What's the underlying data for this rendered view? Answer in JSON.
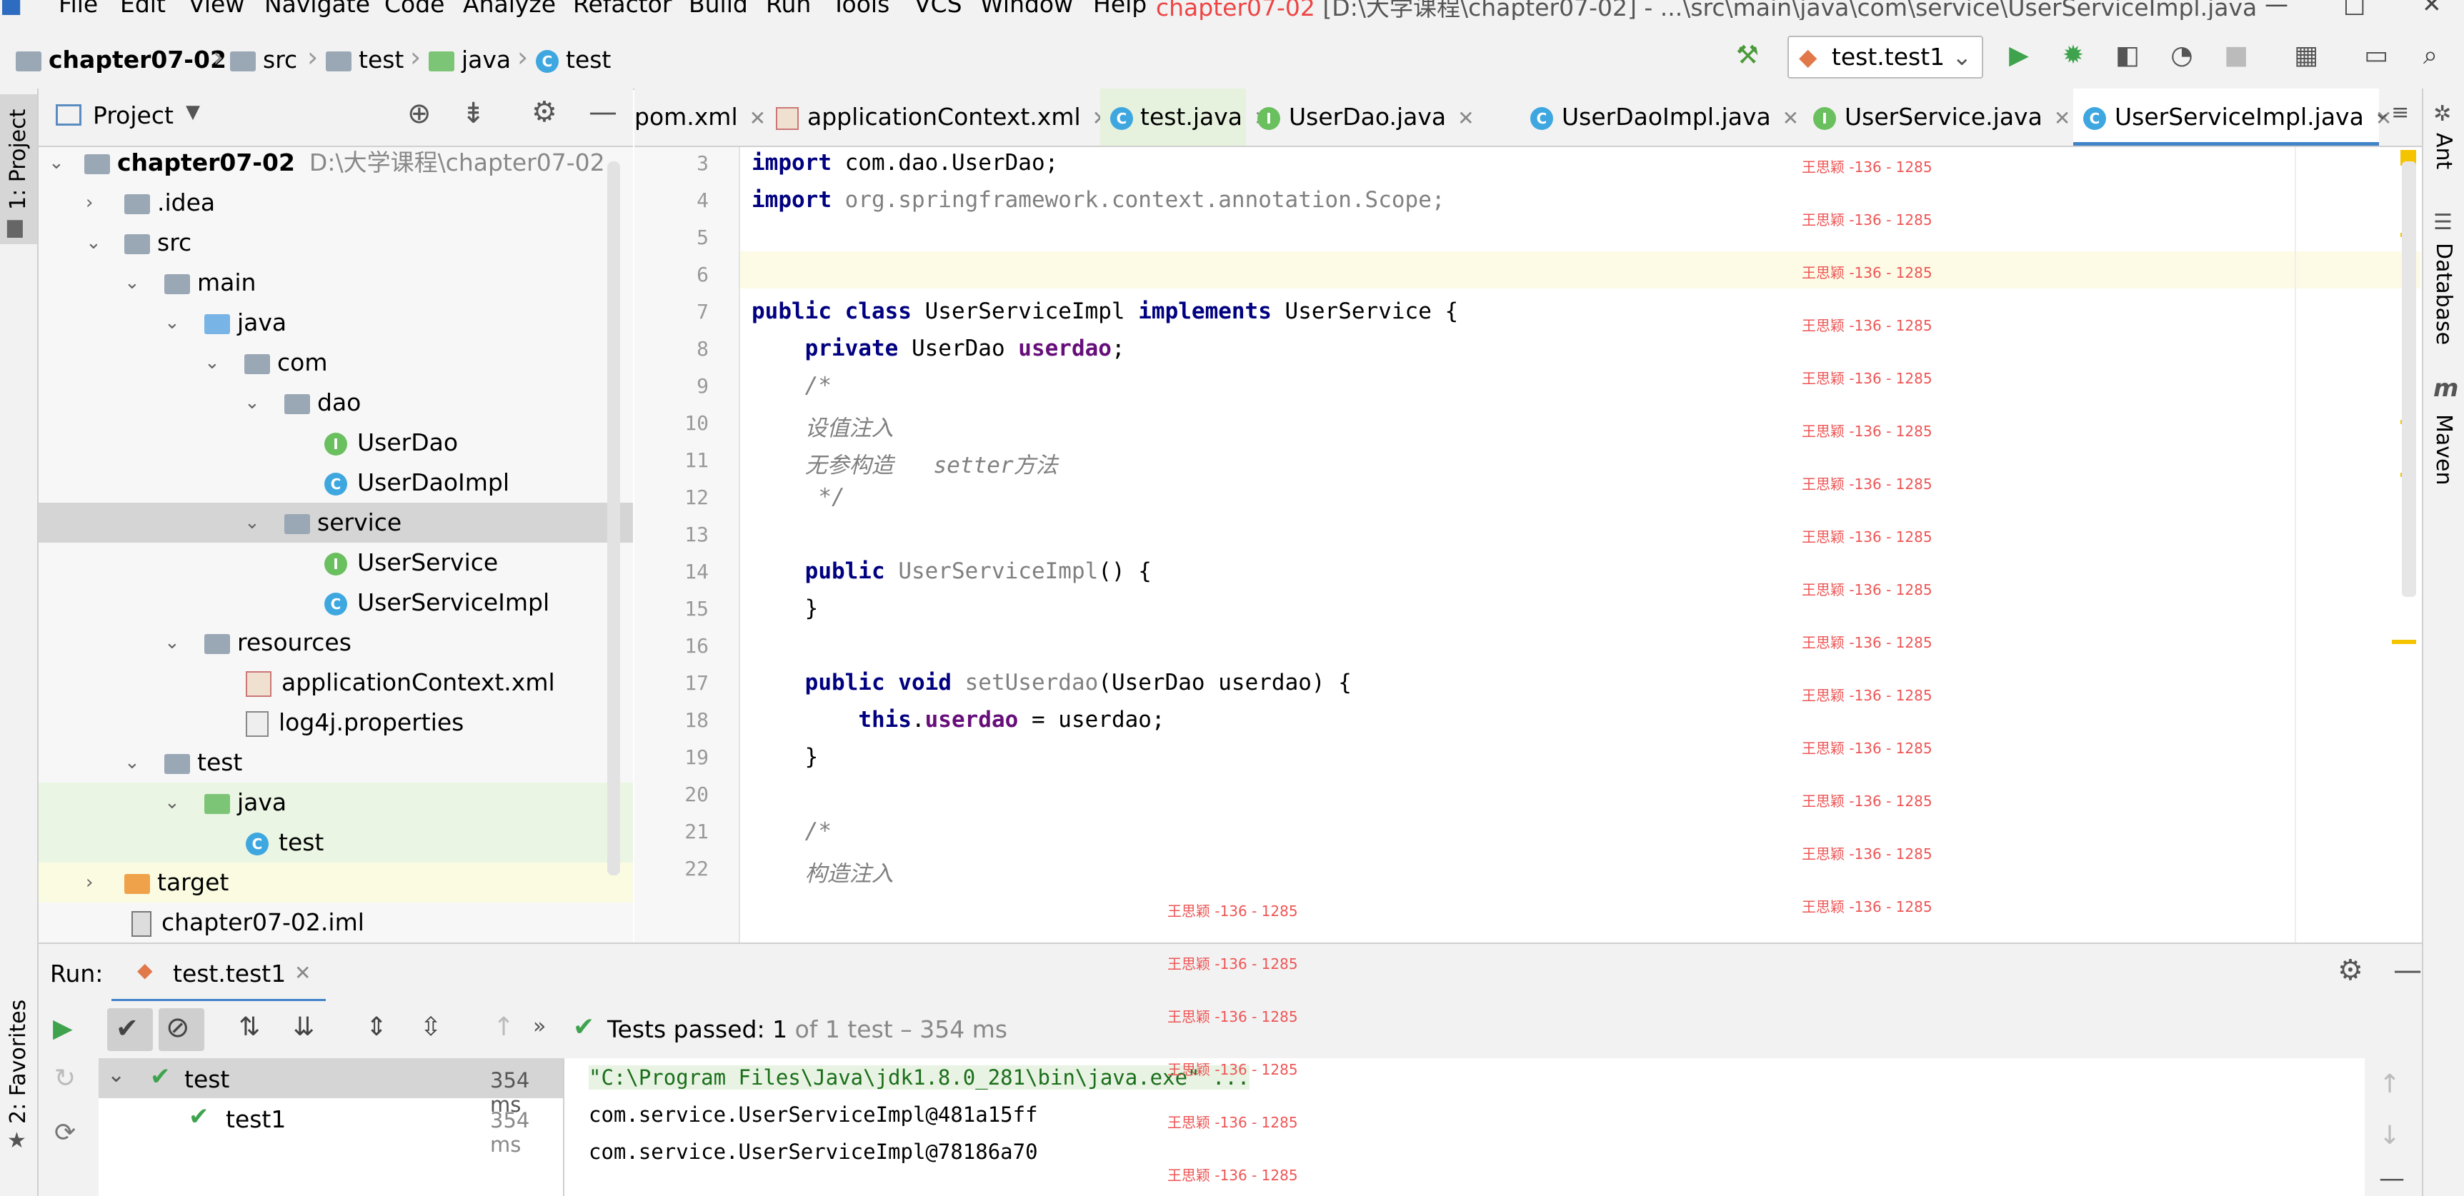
{
  "menu": [
    "File",
    "Edit",
    "View",
    "Navigate",
    "Code",
    "Analyze",
    "Refactor",
    "Build",
    "Run",
    "Tools",
    "VCS",
    "Window",
    "Help"
  ],
  "window_title": {
    "project": "chapter07-02",
    "path": "[D:\\大学课程\\chapter07-02] - ...\\src\\main\\java\\com\\service\\UserServiceImpl.java"
  },
  "breadcrumb": [
    "chapter07-02",
    "src",
    "test",
    "java",
    "test"
  ],
  "run_config": "test.test1",
  "left_strip": {
    "project": "1: Project",
    "favorites": "2: Favorites"
  },
  "right_strip": [
    "Ant",
    "Database",
    "Maven"
  ],
  "project_panel": {
    "title": "Project"
  },
  "tree": [
    {
      "label": "chapter07-02",
      "path": "D:\\大学课程\\chapter07-02"
    },
    {
      "label": ".idea"
    },
    {
      "label": "src"
    },
    {
      "label": "main"
    },
    {
      "label": "java"
    },
    {
      "label": "com"
    },
    {
      "label": "dao"
    },
    {
      "label": "UserDao"
    },
    {
      "label": "UserDaoImpl"
    },
    {
      "label": "service"
    },
    {
      "label": "UserService"
    },
    {
      "label": "UserServiceImpl"
    },
    {
      "label": "resources"
    },
    {
      "label": "applicationContext.xml"
    },
    {
      "label": "log4j.properties"
    },
    {
      "label": "test"
    },
    {
      "label": "java"
    },
    {
      "label": "test"
    },
    {
      "label": "target"
    },
    {
      "label": "chapter07-02.iml"
    }
  ],
  "tabs": [
    "pom.xml",
    "applicationContext.xml",
    "test.java",
    "UserDao.java",
    "UserDaoImpl.java",
    "UserService.java",
    "UserServiceImpl.java"
  ],
  "editor": {
    "line_numbers": [
      "3",
      "4",
      "5",
      "6",
      "7",
      "8",
      "9",
      "10",
      "11",
      "12",
      "13",
      "14",
      "15",
      "16",
      "17",
      "18",
      "19",
      "20",
      "21",
      "22"
    ],
    "watermark": "王思颖 -136 - 1285"
  },
  "run_panel": {
    "label": "Run:",
    "tab": "test.test1",
    "status_main": "Tests passed: 1",
    "status_rest": "of 1 test – 354 ms",
    "tests": [
      {
        "name": "test",
        "time": "354 ms"
      },
      {
        "name": "test1",
        "time": "354 ms"
      }
    ],
    "console": [
      "\"C:\\Program Files\\Java\\jdk1.8.0_281\\bin\\java.exe\" ...",
      "com.service.UserServiceImpl@481a15ff",
      "com.service.UserServiceImpl@78186a70"
    ]
  }
}
